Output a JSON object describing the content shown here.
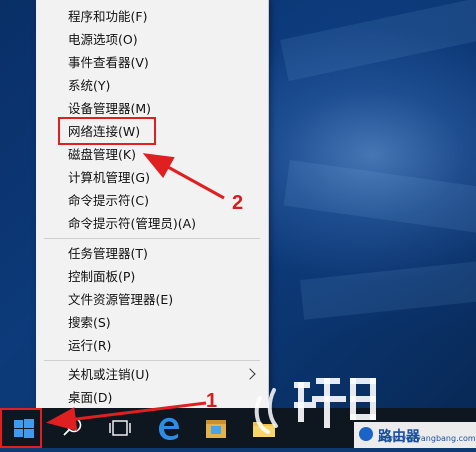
{
  "menu": {
    "items": [
      {
        "label": "程序和功能(F)"
      },
      {
        "label": "电源选项(O)"
      },
      {
        "label": "事件查看器(V)"
      },
      {
        "label": "系统(Y)"
      },
      {
        "label": "设备管理器(M)"
      },
      {
        "label": "网络连接(W)"
      },
      {
        "label": "磁盘管理(K)"
      },
      {
        "label": "计算机管理(G)"
      },
      {
        "label": "命令提示符(C)"
      },
      {
        "label": "命令提示符(管理员)(A)"
      },
      {
        "label": "任务管理器(T)"
      },
      {
        "label": "控制面板(P)"
      },
      {
        "label": "文件资源管理器(E)"
      },
      {
        "label": "搜索(S)"
      },
      {
        "label": "运行(R)"
      },
      {
        "label": "关机或注销(U)"
      },
      {
        "label": "桌面(D)"
      }
    ]
  },
  "annotations": {
    "step1": "1",
    "step2": "2",
    "color": "#e02020"
  },
  "taskbar": {
    "icons": [
      "windows-logo-icon",
      "search-icon",
      "task-view-icon",
      "edge-icon",
      "store-icon",
      "file-explorer-icon"
    ]
  },
  "watermark": {
    "site": "www.yueyangbang.com",
    "brand_text": "路由器"
  },
  "colors": {
    "menu_bg": "#f2f2f2",
    "taskbar_bg": "#0e1620",
    "desktop_bg": "#0c3a7a",
    "annotation_red": "#e02020"
  }
}
